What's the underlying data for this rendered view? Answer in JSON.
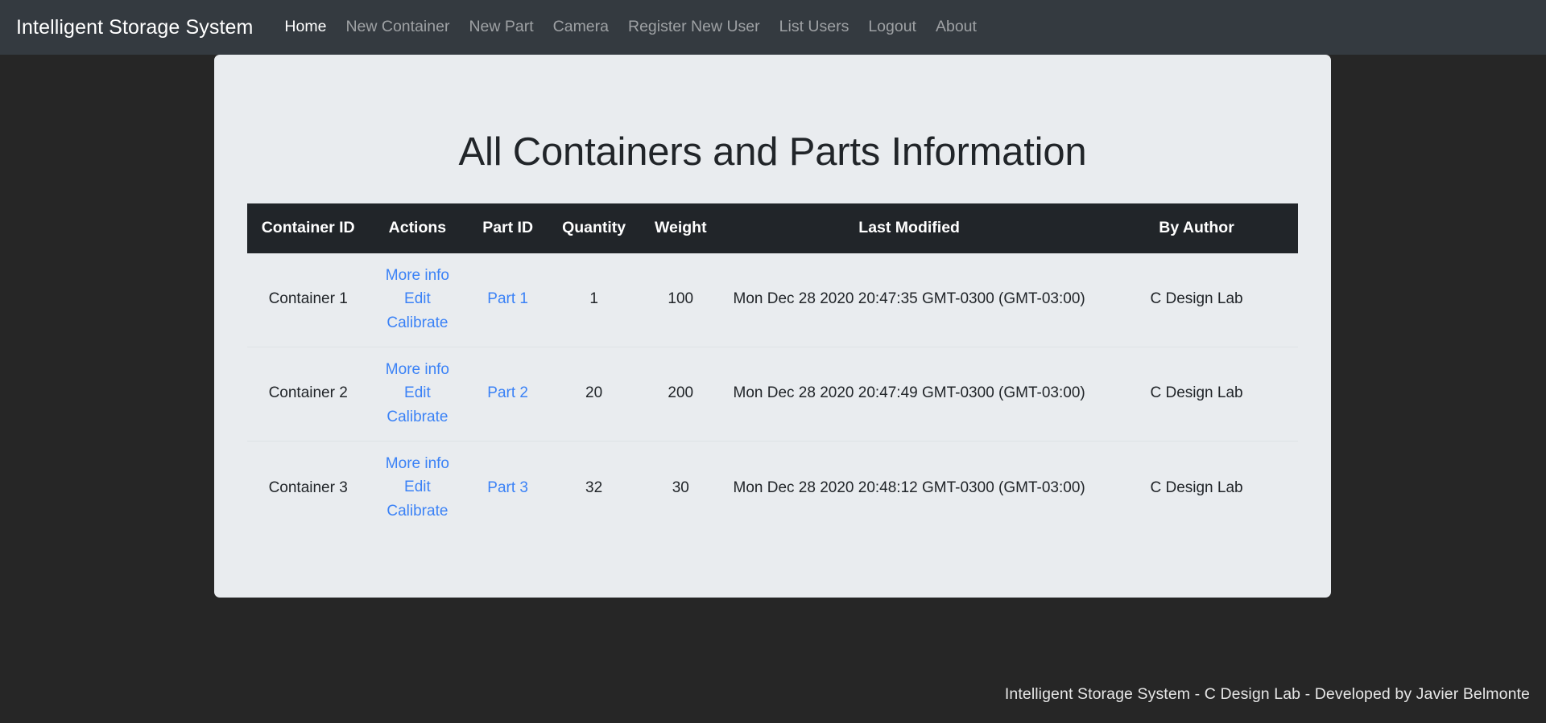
{
  "navbar": {
    "brand": "Intelligent Storage System",
    "links": [
      {
        "label": "Home",
        "active": true
      },
      {
        "label": "New Container",
        "active": false
      },
      {
        "label": "New Part",
        "active": false
      },
      {
        "label": "Camera",
        "active": false
      },
      {
        "label": "Register New User",
        "active": false
      },
      {
        "label": "List Users",
        "active": false
      },
      {
        "label": "Logout",
        "active": false
      },
      {
        "label": "About",
        "active": false
      }
    ]
  },
  "main": {
    "title": "All Containers and Parts Information",
    "table": {
      "headers": [
        "Container ID",
        "Actions",
        "Part ID",
        "Quantity",
        "Weight",
        "Last Modified",
        "By Author"
      ],
      "action_labels": {
        "more_info": "More info",
        "edit": "Edit",
        "calibrate": "Calibrate"
      },
      "rows": [
        {
          "container_id": "Container 1",
          "actions": [
            "More info",
            "Edit",
            "Calibrate"
          ],
          "part_id": "Part 1",
          "quantity": "1",
          "weight": "100",
          "last_modified": "Mon Dec 28 2020 20:47:35 GMT-0300 (GMT-03:00)",
          "by_author": "C Design Lab"
        },
        {
          "container_id": "Container 2",
          "actions": [
            "More info",
            "Edit",
            "Calibrate"
          ],
          "part_id": "Part 2",
          "quantity": "20",
          "weight": "200",
          "last_modified": "Mon Dec 28 2020 20:47:49 GMT-0300 (GMT-03:00)",
          "by_author": "C Design Lab"
        },
        {
          "container_id": "Container 3",
          "actions": [
            "More info",
            "Edit",
            "Calibrate"
          ],
          "part_id": "Part 3",
          "quantity": "32",
          "weight": "30",
          "last_modified": "Mon Dec 28 2020 20:48:12 GMT-0300 (GMT-03:00)",
          "by_author": "C Design Lab"
        }
      ]
    }
  },
  "footer": {
    "text": "Intelligent Storage System - C Design Lab - Developed by Javier Belmonte"
  },
  "colors": {
    "navbar_bg": "#343a40",
    "body_bg": "#262626",
    "card_bg": "#e9ecef",
    "table_header_bg": "#212529",
    "link": "#3b82f6",
    "text": "#212529"
  }
}
